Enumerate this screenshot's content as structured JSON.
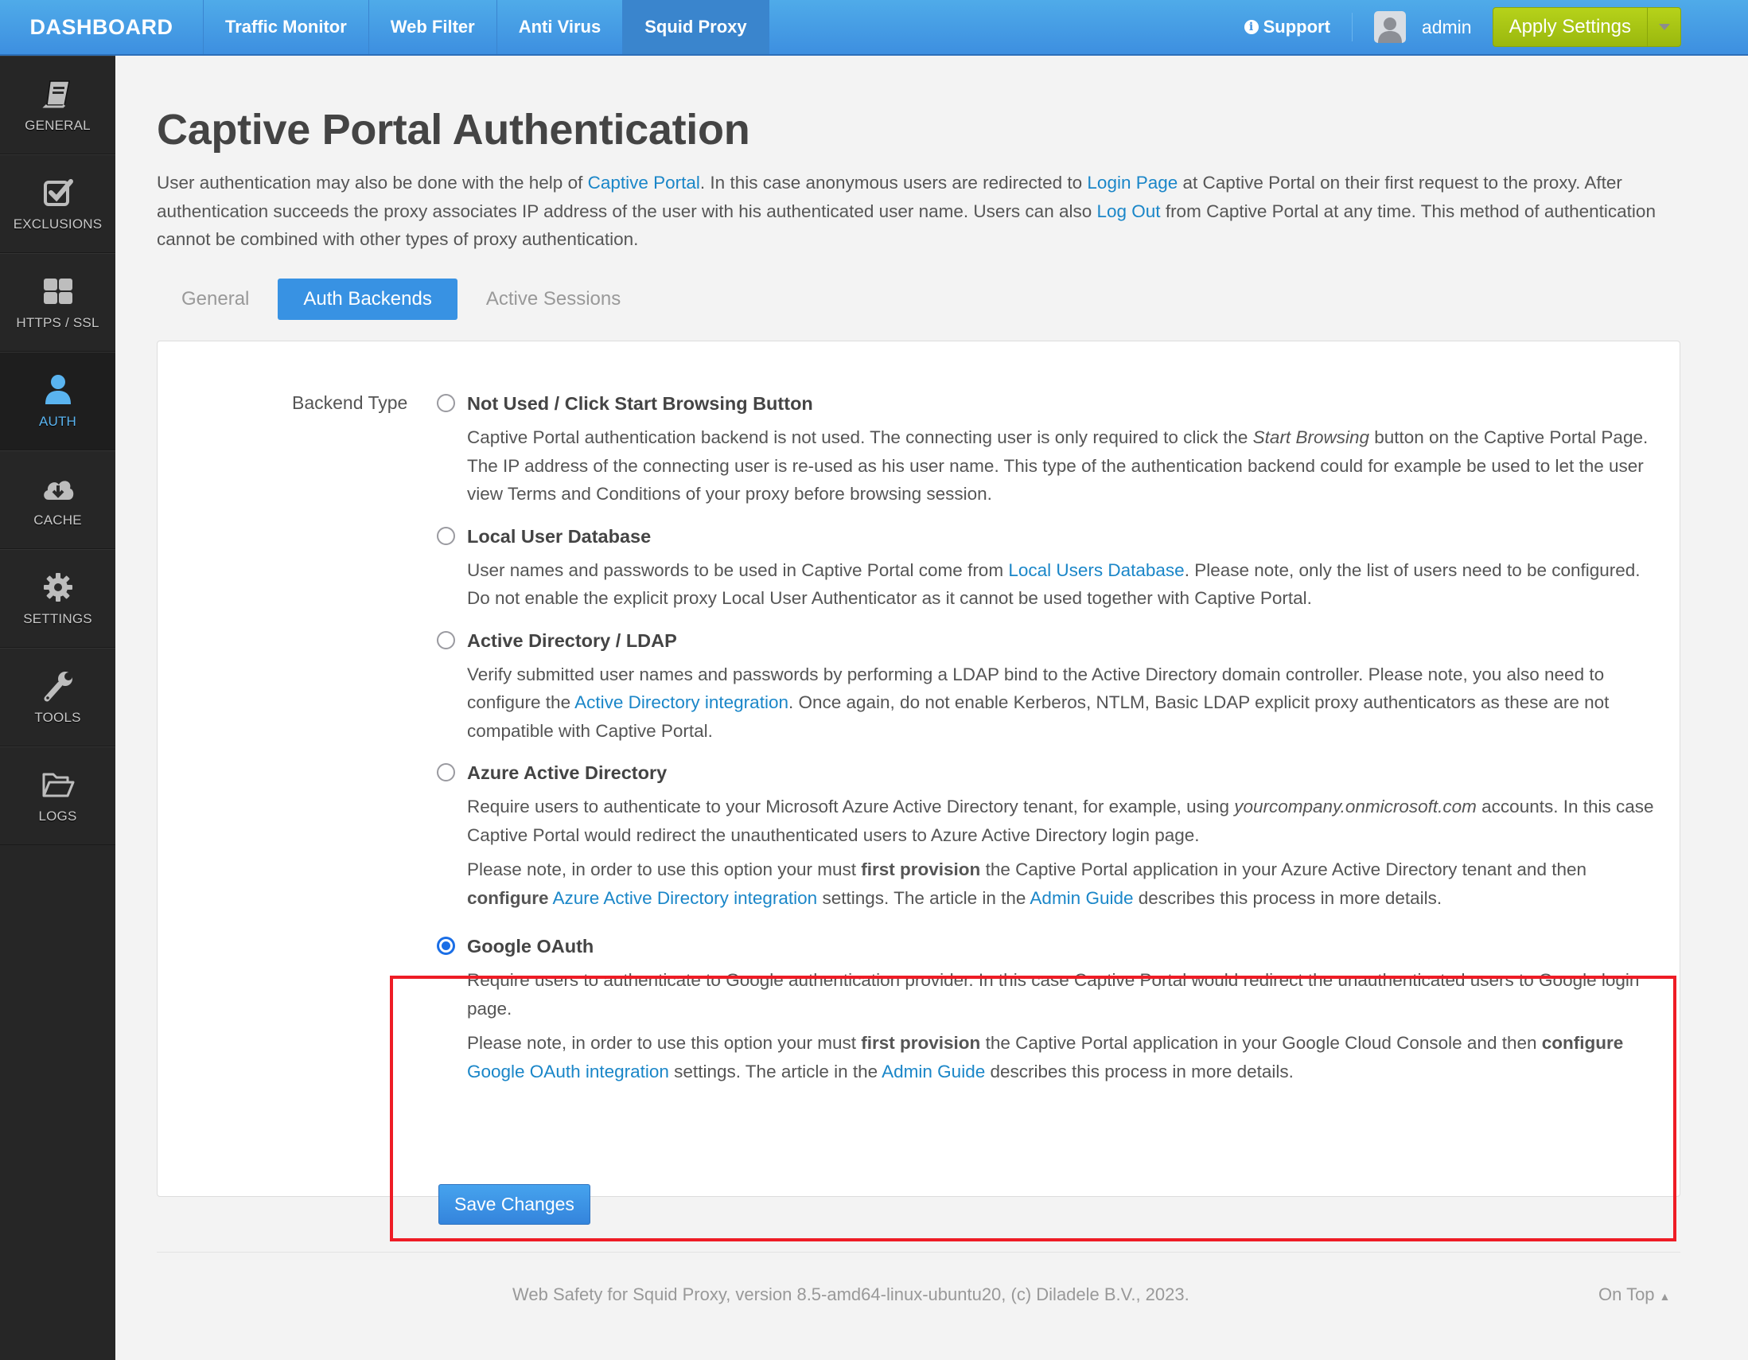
{
  "topbar": {
    "brand": "DASHBOARD",
    "nav": [
      {
        "label": "Traffic Monitor",
        "active": false
      },
      {
        "label": "Web Filter",
        "active": false
      },
      {
        "label": "Anti Virus",
        "active": false
      },
      {
        "label": "Squid Proxy",
        "active": true
      }
    ],
    "support_label": "Support",
    "user": "admin",
    "apply_label": "Apply Settings"
  },
  "sidebar": {
    "items": [
      {
        "label": "GENERAL",
        "icon": "book-icon"
      },
      {
        "label": "EXCLUSIONS",
        "icon": "checkbox-icon"
      },
      {
        "label": "HTTPS / SSL",
        "icon": "grid-icon"
      },
      {
        "label": "AUTH",
        "icon": "user-icon",
        "active": true
      },
      {
        "label": "CACHE",
        "icon": "cloud-download-icon"
      },
      {
        "label": "SETTINGS",
        "icon": "gear-icon"
      },
      {
        "label": "TOOLS",
        "icon": "wrench-icon"
      },
      {
        "label": "LOGS",
        "icon": "folder-open-icon"
      }
    ]
  },
  "page": {
    "title": "Captive Portal Authentication",
    "intro": {
      "t1": "User authentication may also be done with the help of ",
      "link1": "Captive Portal",
      "t2": ". In this case anonymous users are redirected to ",
      "link2": "Login Page",
      "t3": " at Captive Portal on their first request to the proxy. After authentication succeeds the proxy associates IP address of the user with his authenticated user name. Users can also ",
      "link3": "Log Out",
      "t4": " from Captive Portal at any time. This method of authentication cannot be combined with other types of proxy authentication."
    },
    "tabs": [
      {
        "label": "General",
        "active": false
      },
      {
        "label": "Auth Backends",
        "active": true
      },
      {
        "label": "Active Sessions",
        "active": false
      }
    ]
  },
  "form": {
    "field_label": "Backend Type",
    "selected": "Google OAuth",
    "options": {
      "not_used": {
        "title": "Not Used / Click Start Browsing Button",
        "d1": "Captive Portal authentication backend is not used. The connecting user is only required to click the ",
        "d1_em": "Start Browsing",
        "d1_rest": " button on the Captive Portal Page. The IP address of the connecting user is re-used as his user name. This type of the authentication backend could for example be used to let the user view Terms and Conditions of your proxy before browsing session."
      },
      "local_db": {
        "title": "Local User Database",
        "d1": "User names and passwords to be used in Captive Portal come from ",
        "link": "Local Users Database",
        "d1_rest": ". Please note, only the list of users need to be configured. Do not enable the explicit proxy Local User Authenticator as it cannot be used together with Captive Portal."
      },
      "ad_ldap": {
        "title": "Active Directory / LDAP",
        "d1": "Verify submitted user names and passwords by performing a LDAP bind to the Active Directory domain controller. Please note, you also need to configure the ",
        "link": "Active Directory integration",
        "d1_rest": ". Once again, do not enable Kerberos, NTLM, Basic LDAP explicit proxy authenticators as these are not compatible with Captive Portal."
      },
      "azure": {
        "title": "Azure Active Directory",
        "d1": "Require users to authenticate to your Microsoft Azure Active Directory tenant, for example, using ",
        "d1_em": "yourcompany.onmicrosoft.com",
        "d1_rest": " accounts. In this case Captive Portal would redirect the unauthenticated users to Azure Active Directory login page.",
        "d2_a": "Please note, in order to use this option your must ",
        "d2_b1": "first provision",
        "d2_b": " the Captive Portal application in your Azure Active Directory tenant and then ",
        "d2_b2": "configure",
        "d2_sp": " ",
        "d2_link1": "Azure Active Directory integration",
        "d2_c": " settings. The article in the ",
        "d2_link2": "Admin Guide",
        "d2_d": " describes this process in more details."
      },
      "google": {
        "title": "Google OAuth",
        "d1": "Require users to authenticate to Google authentication provider. In this case Captive Portal would redirect the unauthenticated users to Google login page.",
        "d2_a": "Please note, in order to use this option your must ",
        "d2_b1": "first provision",
        "d2_b": " the Captive Portal application in your Google Cloud Console and then ",
        "d2_b2": "configure",
        "d2_sp": " ",
        "d2_link1": "Google OAuth integration",
        "d2_c": " settings. The article in the ",
        "d2_link2": "Admin Guide",
        "d2_d": " describes this process in more details."
      }
    },
    "save_label": "Save Changes"
  },
  "footer": {
    "text": "Web Safety for Squid Proxy, version 8.5-amd64-linux-ubuntu20, (c) Diladele B.V., 2023.",
    "on_top": "On Top"
  },
  "colors": {
    "accent": "#3892e3",
    "apply": "#a8c414",
    "highlight": "#ee1c25",
    "link": "#1a86c8"
  }
}
